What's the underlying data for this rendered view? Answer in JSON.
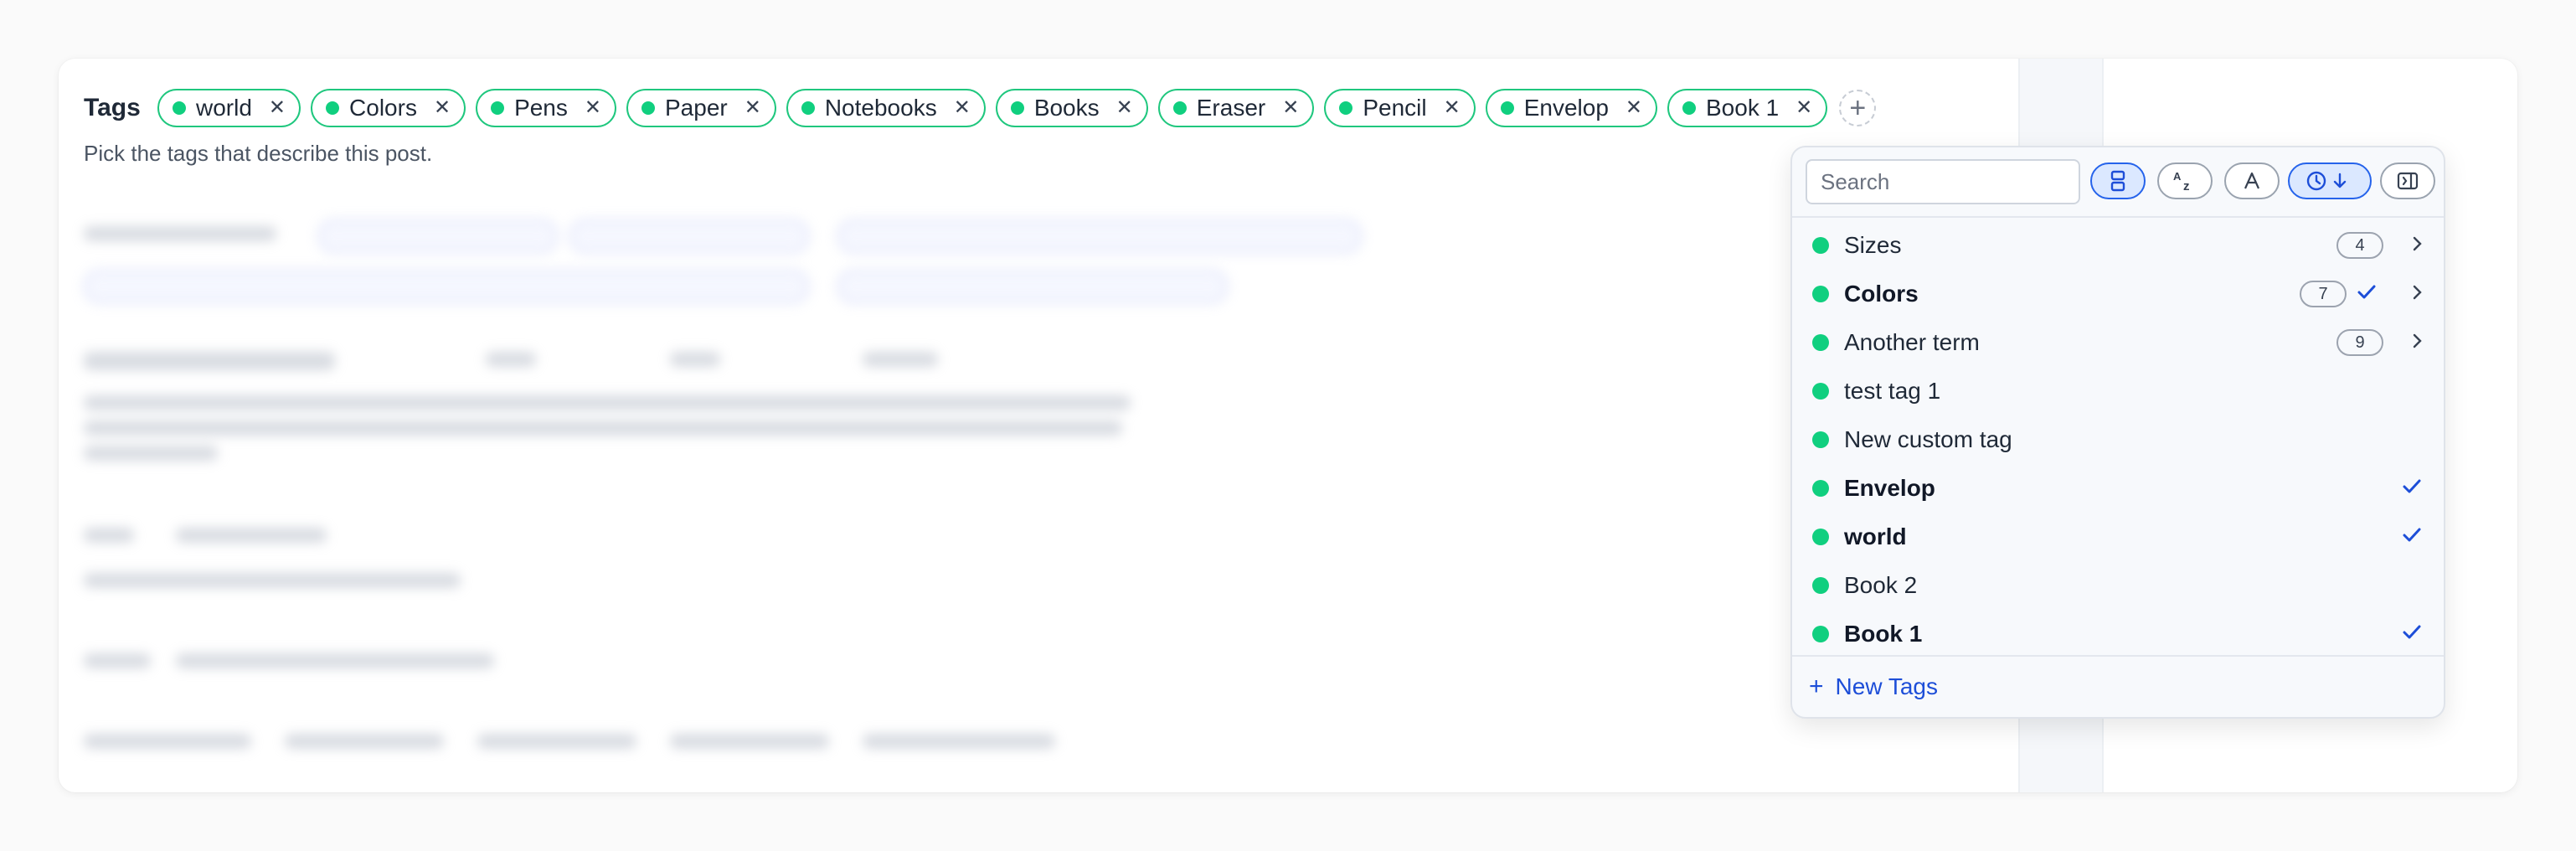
{
  "form": {
    "label": "Tags",
    "helper": "Pick the tags that describe this post."
  },
  "selected_tags": [
    "world",
    "Colors",
    "Pens",
    "Paper",
    "Notebooks",
    "Books",
    "Eraser",
    "Pencil",
    "Envelop",
    "Book 1"
  ],
  "dropdown": {
    "search_placeholder": "Search",
    "toolbar": [
      {
        "icon": "group-icon",
        "active": true
      },
      {
        "icon": "sort-alpha-icon",
        "active": false
      },
      {
        "icon": "font-icon",
        "active": false
      },
      {
        "icon": "clock-sort-desc-icon",
        "active": true
      },
      {
        "icon": "sidebar-panel-icon",
        "active": false
      }
    ],
    "items": [
      {
        "name": "Sizes",
        "count": "4",
        "checked": false,
        "submenu": true
      },
      {
        "name": "Colors",
        "count": "7",
        "checked": true,
        "submenu": true
      },
      {
        "name": "Another term",
        "count": "9",
        "checked": false,
        "submenu": true
      },
      {
        "name": "test tag 1",
        "count": null,
        "checked": false,
        "submenu": false
      },
      {
        "name": "New custom tag",
        "count": null,
        "checked": false,
        "submenu": false
      },
      {
        "name": "Envelop",
        "count": null,
        "checked": true,
        "submenu": false
      },
      {
        "name": "world",
        "count": null,
        "checked": true,
        "submenu": false
      },
      {
        "name": "Book 2",
        "count": null,
        "checked": false,
        "submenu": false
      },
      {
        "name": "Book 1",
        "count": null,
        "checked": true,
        "submenu": false
      }
    ],
    "footer_label": "New Tags"
  },
  "colors": {
    "tag_green": "#10cf7f",
    "accent_blue": "#1d4ed8"
  }
}
